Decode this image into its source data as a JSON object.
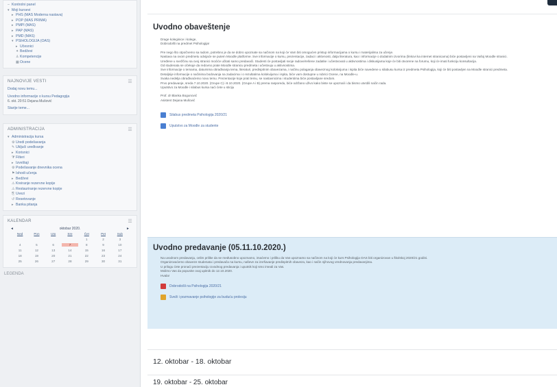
{
  "sidebar": {
    "nav_items": [
      {
        "label": "Kontrolni panel",
        "icon": "dash-icon",
        "indent": 0,
        "dark": false
      },
      {
        "label": "Moji kursevi",
        "icon": "caret-down-icon",
        "indent": 0,
        "dark": false
      },
      {
        "label": "PHS (MAS Moderna nastava)",
        "icon": "caret-right-icon",
        "indent": 1,
        "dark": false
      },
      {
        "label": "POP (MAS PRIMA)",
        "icon": "caret-right-icon",
        "indent": 1,
        "dark": false
      },
      {
        "label": "PMPI (MAS)",
        "icon": "caret-right-icon",
        "indent": 1,
        "dark": false
      },
      {
        "label": "PAP (MAS)",
        "icon": "caret-right-icon",
        "indent": 1,
        "dark": false
      },
      {
        "label": "PMD (MAS)",
        "icon": "caret-right-icon",
        "indent": 1,
        "dark": false
      },
      {
        "label": "PSIHOLOGIJA (OAS)",
        "icon": "caret-down-icon",
        "indent": 1,
        "dark": false
      },
      {
        "label": "Učesnici",
        "icon": "caret-right-icon",
        "indent": 2,
        "dark": false
      },
      {
        "label": "Bedževi",
        "icon": "badge-icon",
        "indent": 2,
        "dark": false
      },
      {
        "label": "Kompetencije",
        "icon": "competency-icon",
        "indent": 2,
        "dark": false
      },
      {
        "label": "Ocene",
        "icon": "grades-icon",
        "indent": 2,
        "dark": false
      }
    ],
    "news": {
      "title": "NAJNOVIJE VESTI",
      "add_link": "Dodaj novu temu...",
      "item_title": "Uvodno informacije o kursu Pedagogija",
      "item_meta": "6. okt. 20:51 Dejana Mušović",
      "older_link": "Starije teme..."
    },
    "admin": {
      "title": "ADMINISTRACIJA",
      "items": [
        {
          "label": "Administracija kursa",
          "icon": "caret-down-icon",
          "indent": 0
        },
        {
          "label": "Uredi podešavanja",
          "icon": "gear-icon",
          "indent": 1
        },
        {
          "label": "Uključi uređivanje",
          "icon": "pencil-icon",
          "indent": 1
        },
        {
          "label": "Korisnici",
          "icon": "caret-right-icon",
          "indent": 1
        },
        {
          "label": "Filteri",
          "icon": "filter-icon",
          "indent": 1
        },
        {
          "label": "Izveštaji",
          "icon": "caret-right-icon",
          "indent": 1
        },
        {
          "label": "Podešavanje dnevnika ocena",
          "icon": "gradebook-icon",
          "indent": 1
        },
        {
          "label": "Ishodi učenja",
          "icon": "outcomes-icon",
          "indent": 1
        },
        {
          "label": "Bedževi",
          "icon": "caret-right-icon",
          "indent": 1
        },
        {
          "label": "Kreiranje rezervne kopije",
          "icon": "backup-icon",
          "indent": 1
        },
        {
          "label": "Restauriranje rezervne kopije",
          "icon": "restore-icon",
          "indent": 1
        },
        {
          "label": "Uvezi",
          "icon": "import-icon",
          "indent": 1
        },
        {
          "label": "Resetovanje",
          "icon": "reset-icon",
          "indent": 1
        },
        {
          "label": "Banka pitanja",
          "icon": "caret-right-icon",
          "indent": 1
        }
      ]
    },
    "calendar": {
      "title": "KALENDAR",
      "month": "oktobar 2020.",
      "weekdays": [
        "Ned",
        "Pon",
        "Uto",
        "Sre",
        "Čet",
        "Pet",
        "Sub"
      ],
      "days": [
        "",
        "",
        "",
        "",
        "1",
        "2",
        "3",
        "4",
        "5",
        "6",
        "7",
        "8",
        "9",
        "10",
        "11",
        "12",
        "13",
        "14",
        "15",
        "16",
        "17",
        "18",
        "19",
        "20",
        "21",
        "22",
        "23",
        "24",
        "25",
        "26",
        "27",
        "28",
        "29",
        "30",
        "31"
      ],
      "today": "7",
      "legend": "LEGENDA"
    }
  },
  "main": {
    "section1": {
      "title": "Uvodno obaveštenje",
      "paragraphs": [
        "Drage koleginice i kolege,",
        "Dobrodošli na predmet Psihologija!",
        "Pre nego što otpočnemo sa radom, potrebno je da se dobro upoznate sa načinom na koji će Vam biti omogućen pristup informacijama o kursu i materijalima za učenje.",
        "Nastava na ovom predmetu odvijaće se putem Moodle platforme. Sve informacije o kursu, prezentacije, zadaci i aktivnosti, dalja literatura, kao i informacije o dodatnim izvorima (linkovi ka internet stranicama) biće postavljeni na Vašoj Moodle stranici.",
        "Uređene u svežčinu sa ovoj stranici moćiće učitati samo predavači. Studenti će postavljati svoje radove/rešene zadatke i učestvovati u aktivnostima i diskusijama koje će biti otvorene na forumu, koji će imati funkciju konsultacija.",
        "Od studenata se očekuje da redovno prate Moodle stranicu predmeta i učestvuju u aktivnostima.",
        "Sve informacije o temama, datumima obrađivanja tema, literaturi, predispitnim obavezama, i načinu polaganja obaveznog kolokvijuma i ispita biće navedene u silabusu kursa iz predmeta Psihologija, koji će biti postavljen na Moodle stranici predmeta.",
        "Detaljnije informacije o načinima bodovanja na zadacima i o rezultatima kolokvijuma i ispita, biće vam dostupne u rubrici Ocene, na Moodle-u.",
        "Svaka nedelja obrađivaćemo novu temu. Prezentacije koje prati temu, se nastavnicima i studentima biće postavljane sredom.",
        "Prvo predavanje, sreda 7.10.2020. (Grupe C) i 8.10.2020. (Grupe A i B) prema rasporedu, biće održano uživo kako biste se upoznali i da bismo utvrdili način rada.",
        "Uputstvo za Moodle i silabus kursa naći ćete u sticiju",
        "Prof. dr Blanka Bogunović",
        "Asistent Dejana Mušović"
      ],
      "resources": [
        {
          "label": "Silabus predmeta Psihologija 2020/21",
          "icon": "document-icon"
        },
        {
          "label": "Uputstvo za Moodle za studente",
          "icon": "document-icon"
        }
      ]
    },
    "section2": {
      "title": "Uvodno predavanje (05.11.10.2020.)",
      "paragraphs": [
        "Na uvodnom predavanju, celim prilike da se međusobno upoznamo, imaćemo i priliku da Vas upoznamo sa načinom na koji će kurs Psihologija OAS biti organizovan u školskoj 2020/21 godini.",
        "Organizovaćemo obaveze studenata i predavača na kursu, naševe za izvršavanje predispitnih obaveza, kao i način njihovog vrednovanja predavanjima.",
        "U prilogu ćete pronaći prezentaciju Uvodnog predavanja i uputnik koji smo imeali za Vas.",
        "Molimo Vas da popunite ovaj upitnik do 12.10.2020.",
        "Hvala!"
      ],
      "resources": [
        {
          "label": "Dobrodošli na Psihologija 2020/21",
          "icon": "pdf-icon"
        },
        {
          "label": "Sveži i pozmavanje psihologije za buduću prolesiju",
          "icon": "feedback-icon"
        }
      ]
    },
    "section3": {
      "title": "12. oktobar - 18. oktobar"
    },
    "section4": {
      "title": "19. oktobar - 25. oktobar"
    }
  }
}
